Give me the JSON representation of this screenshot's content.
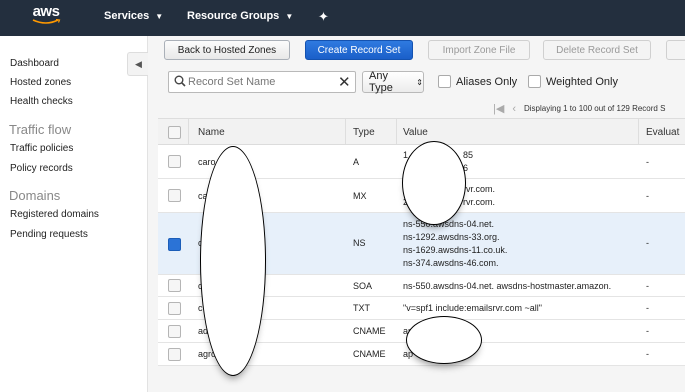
{
  "topbar": {
    "logo": "aws",
    "services_label": "Services",
    "resource_groups_label": "Resource Groups",
    "pin_icon": "pushpin-icon"
  },
  "sidebar": {
    "items_top": [
      "Dashboard",
      "Hosted zones",
      "Health checks"
    ],
    "traffic_flow_heading": "Traffic flow",
    "traffic_flow_items": [
      "Traffic policies",
      "Policy records"
    ],
    "domains_heading": "Domains",
    "domains_items": [
      "Registered domains",
      "Pending requests"
    ]
  },
  "toolbar": {
    "back_label": "Back to Hosted Zones",
    "create_label": "Create Record Set",
    "import_label": "Import Zone File",
    "delete_label": "Delete Record Set"
  },
  "filters": {
    "search_placeholder": "Record Set Name",
    "type_select": "Any Type",
    "aliases_label": "Aliases Only",
    "weighted_label": "Weighted Only"
  },
  "pager": {
    "text": "Displaying 1 to 100 out of 129 Record S"
  },
  "table": {
    "headers": {
      "name": "Name",
      "type": "Type",
      "value": "Value",
      "evaluate": "Evaluat"
    },
    "rows": [
      {
        "name": "caro",
        "type": "A",
        "value": [
          "1",
          "85",
          "6"
        ],
        "evaluate": "-",
        "selected": false
      },
      {
        "name": "ca",
        "type": "MX",
        "value": [
          "rvr.com.",
          "2",
          "rvr.com."
        ],
        "evaluate": "-",
        "selected": false
      },
      {
        "name": "c",
        "type": "NS",
        "value": [
          "ns-550.awsdns-04.net.",
          "ns-1292.awsdns-33.org.",
          "ns-1629.awsdns-11.co.uk.",
          "ns-374.awsdns-46.com."
        ],
        "evaluate": "-",
        "selected": true
      },
      {
        "name": "c",
        "type": "SOA",
        "value": [
          "ns-550.awsdns-04.net. awsdns-hostmaster.amazon."
        ],
        "evaluate": "-",
        "selected": false
      },
      {
        "name": "c",
        "type": "TXT",
        "value": [
          "\"v=spf1 include:emailsrvr.com ~all\""
        ],
        "evaluate": "-",
        "selected": false
      },
      {
        "name": "ad",
        "type": "CNAME",
        "value": [
          "ap"
        ],
        "evaluate": "-",
        "selected": false
      },
      {
        "name": "agro",
        "type": "CNAME",
        "value": [
          "ap"
        ],
        "evaluate": "-",
        "selected": false
      }
    ]
  },
  "colors": {
    "topbar_bg": "#232f3e",
    "primary_button": "#1a5fc9",
    "selected_row": "#e7f0fa"
  }
}
